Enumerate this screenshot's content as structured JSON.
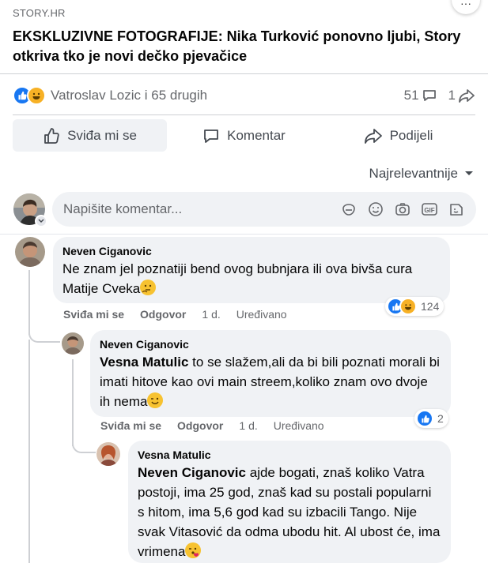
{
  "link_preview": {
    "source": "STORY.HR",
    "headline": "EKSKLUZIVNE FOTOGRAFIJE: Nika Turković ponovno ljubi, Story otkriva tko je novi dečko pjevačice"
  },
  "reactions_summary": {
    "icons": [
      "like-icon",
      "haha-icon"
    ],
    "text": "Vatroslav Lozic i 65 drugih",
    "comments_count": "51",
    "shares_count": "1"
  },
  "actions": {
    "like": "Sviđa mi se",
    "comment": "Komentar",
    "share": "Podijeli"
  },
  "sort": {
    "label": "Najrelevantnije"
  },
  "composer": {
    "placeholder": "Napišite komentar...",
    "icons": [
      "sticker-icon",
      "emoji-icon",
      "camera-icon",
      "gif-icon",
      "avatar-sticker-icon"
    ]
  },
  "comments": [
    {
      "author": "Neven Ciganovic",
      "mention": "",
      "text": "Ne znam jel poznatiji bend ovog bubnjara ili ova bivša cura Matije Cveka",
      "emoji": "thinking-emoji",
      "actions": {
        "like": "Sviđa mi se",
        "reply": "Odgovor",
        "time": "1 d.",
        "edited": "Uređivano"
      },
      "reaction_count": "124",
      "reaction_icons": [
        "like-icon",
        "haha-icon"
      ]
    },
    {
      "author": "Neven Ciganovic",
      "mention": "Vesna Matulic",
      "text": "to se slažem,ali da bi bili poznati morali bi imati hitove kao ovi main streem,koliko znam ovo dvoje ih nema",
      "emoji": "wink-emoji",
      "actions": {
        "like": "Sviđa mi se",
        "reply": "Odgovor",
        "time": "1 d.",
        "edited": "Uređivano"
      },
      "reaction_count": "2",
      "reaction_icons": [
        "like-icon"
      ]
    },
    {
      "author": "Vesna Matulic",
      "mention": "Neven Ciganovic",
      "text": "ajde bogati, znaš koliko Vatra postoji, ima 25 god, znaš kad su postali popularni s hitom, ima 5,6 god kad su izbacili Tango. Nije svak Vitasović da odma ubodu hit. Al ubost će, ima vrimena",
      "emoji": "kiss-emoji"
    }
  ],
  "colors": {
    "accent": "#1877f2",
    "bubble": "#f0f2f5",
    "secondary_text": "#65676b",
    "haha": "#f7b125"
  }
}
